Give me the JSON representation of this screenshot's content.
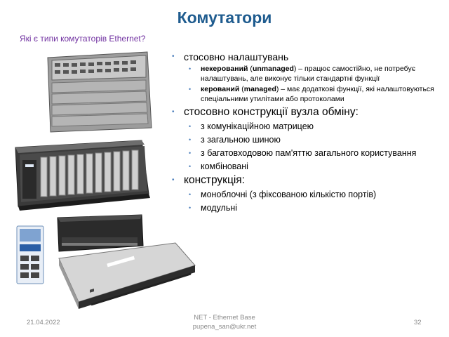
{
  "slide": {
    "title": "Комутатори",
    "subtitle": "Які є типи комутаторів Ethernet?"
  },
  "bullets": {
    "b1": "стосовно налаштувань",
    "b1_1_bold": "некерований",
    "b1_1_text1": " (",
    "b1_1_bold2": "unmanaged",
    "b1_1_text2": ") – працює самостійно, не потребує налаштувань, але виконує тільки стандартні функції",
    "b1_2_bold": "керований",
    "b1_2_text1": " (",
    "b1_2_bold2": "managed",
    "b1_2_text2": ") – має додаткові функції, які налаштовуються спеціальними утилітами або протоколами",
    "b2": "стосовно конструкції вузла обміну:",
    "b2_1": "з комунікаційною матрицею",
    "b2_2": "з загальною шиною",
    "b2_3": "з багатовходовою пам'яттю загального користування",
    "b2_4": "комбіновані",
    "b3": "конструкція:",
    "b3_1": "моноблочні (з фіксованою кількістю портів)",
    "b3_2": "модульні"
  },
  "footer": {
    "date": "21.04.2022",
    "center_line1": "NET - Ethernet Base",
    "center_line2": "pupena_san@ukr.net",
    "page": "32"
  },
  "icons": [
    "chassis-switch-image",
    "rack-switch-image",
    "din-rail-switch-image",
    "desktop-switch-image",
    "rackmount-switch-image"
  ]
}
